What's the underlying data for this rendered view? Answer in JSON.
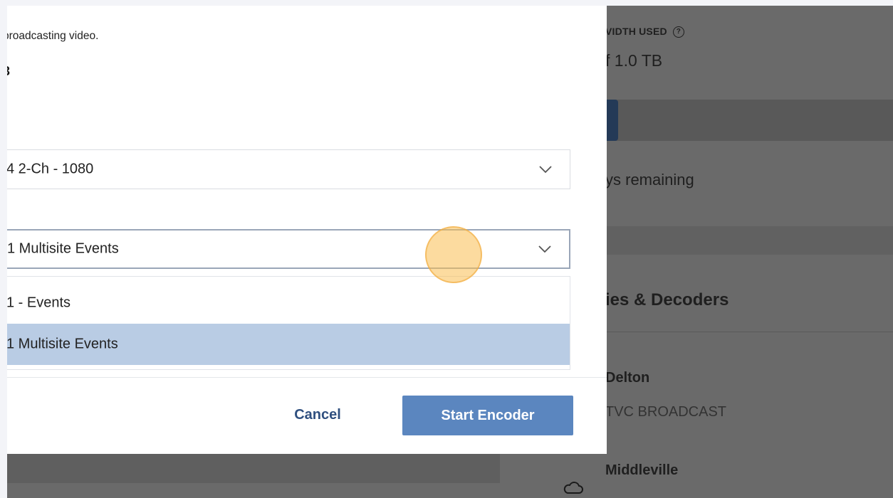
{
  "background": {
    "bandwidth_label": "VIDTH USED",
    "bandwidth_help_icon": "help-circle-icon",
    "bandwidth_value": "f 1.0 TB",
    "bandwidth_used_fraction": 0.25,
    "days_remaining": "ys remaining",
    "section_title": "ies & Decoders",
    "devices": [
      {
        "name": "Delton",
        "subtitle": "TVC BROADCAST"
      },
      {
        "name": "Middleville",
        "icon": "cloud-icon"
      }
    ]
  },
  "modal": {
    "description": "proadcasting video.",
    "channel_id": "3",
    "preset_select": {
      "value": "4 2-Ch - 1080",
      "icon": "chevron-down-icon"
    },
    "event_select": {
      "value": "1 Multisite Events",
      "icon": "chevron-down-icon"
    },
    "event_options": [
      {
        "label": "1 - Events",
        "selected": false
      },
      {
        "label": "1 Multisite Events",
        "selected": true
      }
    ],
    "buttons": {
      "cancel": "Cancel",
      "start": "Start Encoder"
    }
  },
  "colors": {
    "accent": "#5b86bf",
    "selected_option": "#b9cce4",
    "overlay": "#6a6a6a",
    "click_indicator": "#fabe50"
  }
}
